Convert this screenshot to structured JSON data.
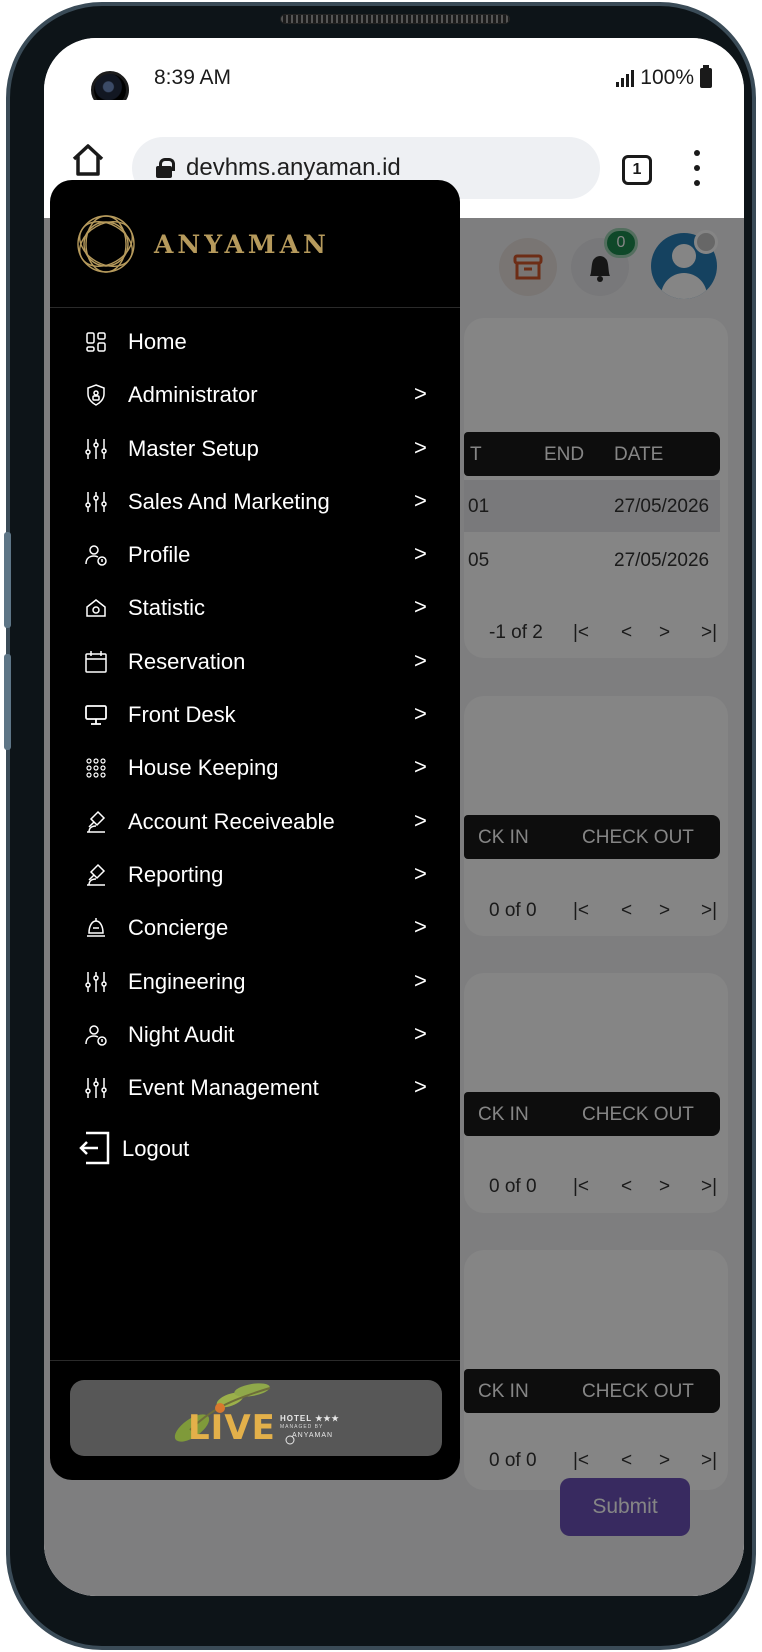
{
  "status_bar": {
    "time": "8:39 AM",
    "battery": "100%"
  },
  "browser": {
    "url": "devhms.anyaman.id",
    "tab_count": "1"
  },
  "header": {
    "notification_count": "0"
  },
  "background_page": {
    "table1": {
      "head_left": "T",
      "head_mid": "END",
      "head_right": "DATE",
      "rows": [
        {
          "left": "01",
          "date": "27/05/2026"
        },
        {
          "left": "05",
          "date": "27/05/2026"
        }
      ],
      "pager": "-1 of 2"
    },
    "table2": {
      "head_left": "CK IN",
      "head_right": "CHECK OUT",
      "pager": "0 of 0"
    },
    "table3": {
      "head_left": "CK IN",
      "head_right": "CHECK OUT",
      "pager": "0 of 0"
    },
    "table4": {
      "head_left": "CK IN",
      "head_right": "CHECK OUT",
      "pager": "0 of 0"
    },
    "pager_icons": {
      "first": "|<",
      "prev": "<",
      "next": ">",
      "last": ">|"
    },
    "submit_label": "Submit"
  },
  "drawer": {
    "brand": "ANYAMAN",
    "menu": [
      {
        "label": "Home",
        "icon": "dashboard-icon",
        "has_children": false
      },
      {
        "label": "Administrator",
        "icon": "shield-icon",
        "has_children": true
      },
      {
        "label": "Master Setup",
        "icon": "sliders-icon",
        "has_children": true
      },
      {
        "label": "Sales And Marketing",
        "icon": "sliders-icon",
        "has_children": true
      },
      {
        "label": "Profile",
        "icon": "user-icon",
        "has_children": true
      },
      {
        "label": "Statistic",
        "icon": "house-icon",
        "has_children": true
      },
      {
        "label": "Reservation",
        "icon": "calendar-icon",
        "has_children": true
      },
      {
        "label": "Front Desk",
        "icon": "monitor-icon",
        "has_children": true
      },
      {
        "label": "House Keeping",
        "icon": "grid-dots-icon",
        "has_children": true
      },
      {
        "label": "Account Receiveable",
        "icon": "microscope-icon",
        "has_children": true
      },
      {
        "label": "Reporting",
        "icon": "microscope-icon",
        "has_children": true
      },
      {
        "label": "Concierge",
        "icon": "bell-desk-icon",
        "has_children": true
      },
      {
        "label": "Engineering",
        "icon": "sliders-icon",
        "has_children": true
      },
      {
        "label": "Night Audit",
        "icon": "user-icon",
        "has_children": true
      },
      {
        "label": "Event Management",
        "icon": "sliders-icon",
        "has_children": true
      }
    ],
    "chevron": ">",
    "logout_label": "Logout",
    "footer": {
      "logo_word": "LIVE",
      "hotel_text": "HOTEL ★★★",
      "managed_by": "MANAGED BY",
      "operator": "ANYAMAN"
    }
  },
  "colors": {
    "drawer_bg": "#000000",
    "brand_gold": "#b69a5c",
    "submit_purple": "#6b52b8",
    "badge_green": "#1d8b4f"
  }
}
